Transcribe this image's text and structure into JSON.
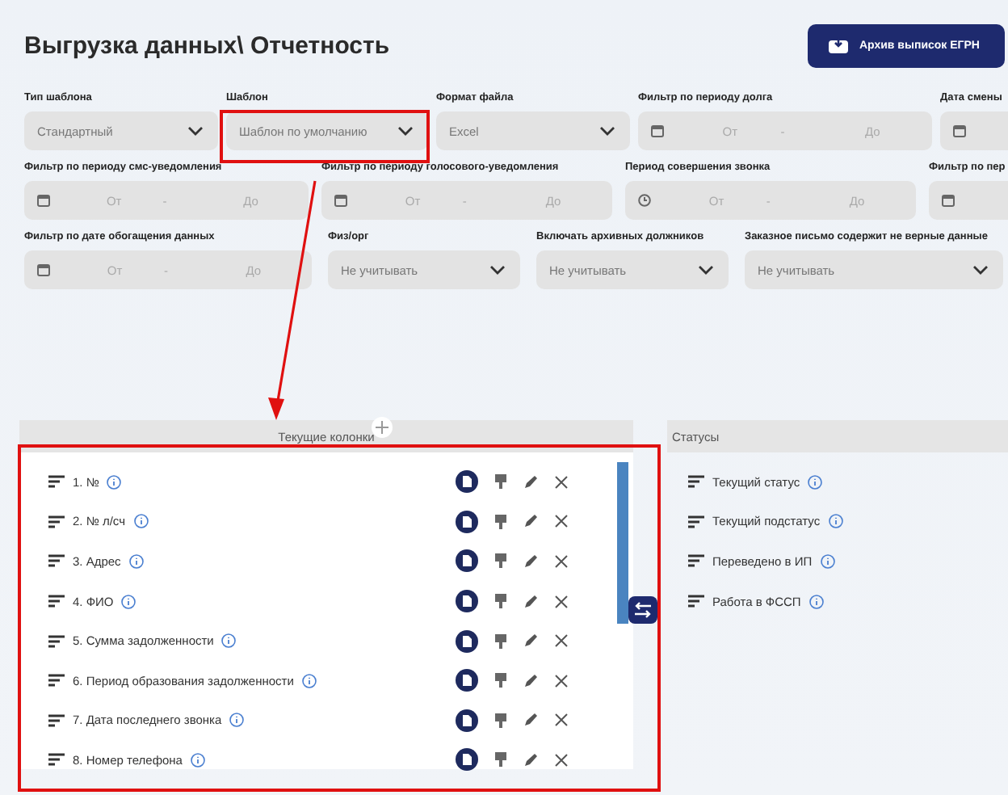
{
  "title": "Выгрузка данных\\ Отчетность",
  "archive_button": "Архив выписок ЕГРН",
  "filter_rows": [
    [
      {
        "label": "Тип шаблона",
        "kind": "select",
        "value": "Стандартный"
      },
      {
        "label": "Шаблон",
        "kind": "select",
        "value": "Шаблон по умолчанию"
      },
      {
        "label": "Формат файла",
        "kind": "select",
        "value": "Excel"
      },
      {
        "label": "Фильтр по периоду долга",
        "kind": "date_range",
        "from": "От",
        "separator": "-",
        "to": "До"
      },
      {
        "label": "Дата смены",
        "kind": "date_range"
      }
    ],
    [
      {
        "label": "Фильтр по периоду смс-уведомления",
        "kind": "date_range",
        "from": "От",
        "separator": "-",
        "to": "До"
      },
      {
        "label": "Фильтр по периоду голосового-уведомления",
        "kind": "date_range",
        "from": "От",
        "separator": "-",
        "to": "До"
      },
      {
        "label": "Период совершения звонка",
        "kind": "time_range",
        "from": "От",
        "separator": "-",
        "to": "До"
      },
      {
        "label": "Фильтр по пер",
        "kind": "date_range"
      }
    ],
    [
      {
        "label": "Фильтр по дате обогащения данных",
        "kind": "date_range",
        "from": "От",
        "separator": "-",
        "to": "До"
      },
      {
        "label": "Физ/орг",
        "kind": "select",
        "value": "Не учитывать"
      },
      {
        "label": "Включать архивных должников",
        "kind": "select",
        "value": "Не учитывать"
      },
      {
        "label": "Заказное письмо содержит не верные данные",
        "kind": "select",
        "value": "Не учитывать"
      }
    ]
  ],
  "columns_panel": {
    "title": "Текущие колонки",
    "items": [
      "1. №",
      "2. № л/сч",
      "3. Адрес",
      "4. ФИО",
      "5. Сумма задолженности",
      "6. Период образования задолженности",
      "7. Дата последнего звонка",
      "8. Номер телефона"
    ]
  },
  "statuses_panel": {
    "title": "Статусы",
    "items": [
      "Текущий статус",
      "Текущий подстатус",
      "Переведено в ИП",
      "Работа в ФССП"
    ]
  }
}
